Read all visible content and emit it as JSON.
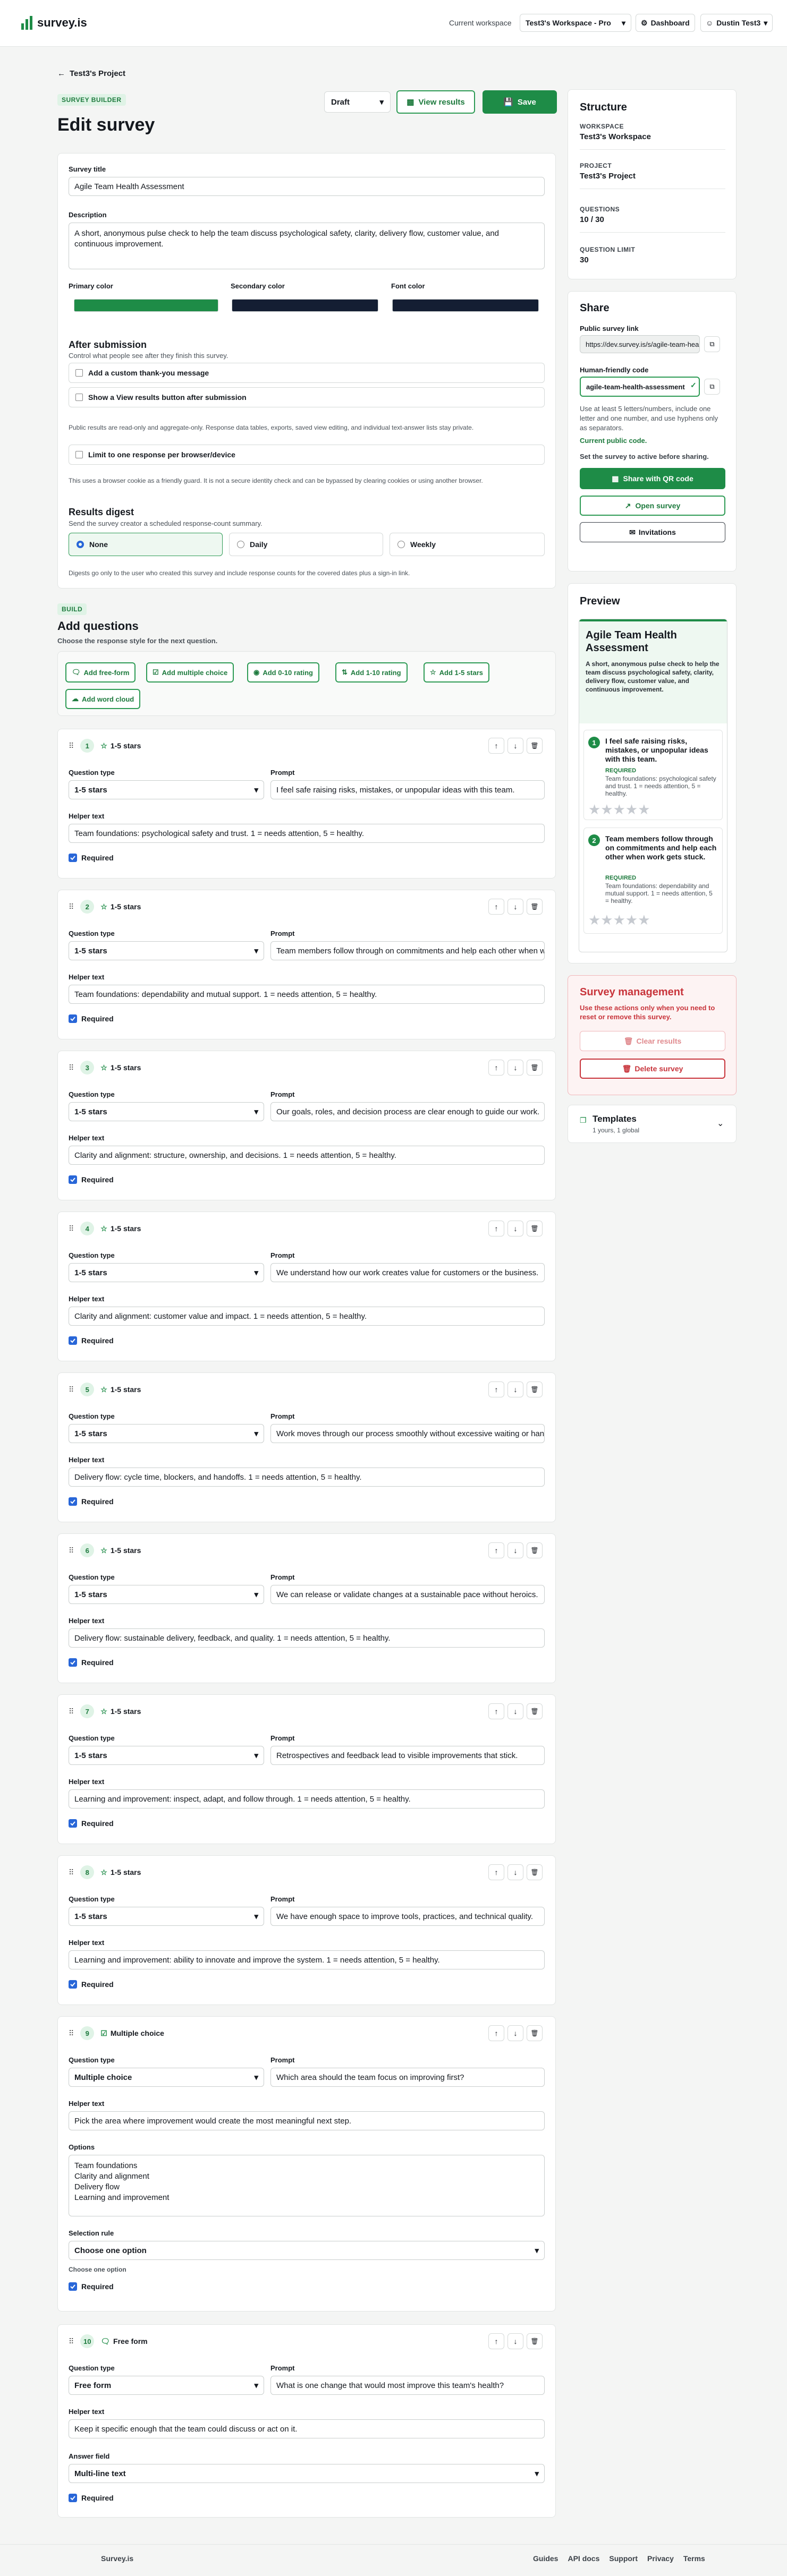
{
  "topbar": {
    "brand": "survey.is",
    "workspace_label": "Current workspace",
    "workspace_value": "Test3's Workspace - Pro",
    "dashboard": "Dashboard",
    "user": "Dustin Test3"
  },
  "header": {
    "back": "Test3's Project",
    "badge": "SURVEY BUILDER",
    "title": "Edit survey",
    "status": "Draft",
    "view_results": "View results",
    "save": "Save"
  },
  "settings": {
    "title_label": "Survey title",
    "title_value": "Agile Team Health Assessment",
    "desc_label": "Description",
    "desc_value": "A short, anonymous pulse check to help the team discuss psychological safety, clarity, delivery flow, customer value, and continuous improvement.",
    "primary_label": "Primary color",
    "primary_color": "#1e8c47",
    "secondary_label": "Secondary color",
    "secondary_color": "#141e33",
    "font_label": "Font color",
    "font_color": "#141e33",
    "after_title": "After submission",
    "after_sub": "Control what people see after they finish this survey.",
    "opt_thankyou": "Add a custom thank-you message",
    "opt_view": "Show a View results button after submission",
    "public_note": "Public results are read-only and aggregate-only. Response data tables, exports, saved view editing, and individual text-answer lists stay private.",
    "opt_limit": "Limit to one response per browser/device",
    "limit_note": "This uses a browser cookie as a friendly guard. It is not a secure identity check and can be bypassed by clearing cookies or using another browser.",
    "digest_title": "Results digest",
    "digest_sub": "Send the survey creator a scheduled response-count summary.",
    "digest_options": [
      "None",
      "Daily",
      "Weekly"
    ],
    "digest_note": "Digests go only to the user who created this survey and include response counts for the covered dates plus a sign-in link."
  },
  "build": {
    "badge": "BUILD",
    "title": "Add questions",
    "sub": "Choose the response style for the next question.",
    "buttons": [
      "Add free-form",
      "Add multiple choice",
      "Add 0-10 rating",
      "Add 1-10 rating",
      "Add 1-5 stars",
      "Add word cloud"
    ]
  },
  "labels": {
    "qtype": "Question type",
    "prompt": "Prompt",
    "helper": "Helper text",
    "required": "Required",
    "options": "Options",
    "selection_rule": "Selection rule",
    "choose_one": "Choose one option",
    "answer_field": "Answer field"
  },
  "questions": [
    {
      "n": "1",
      "type": "1-5 stars",
      "prompt": "I feel safe raising risks, mistakes, or unpopular ideas with this team.",
      "helper": "Team foundations: psychological safety and trust. 1 = needs attention, 5 = healthy."
    },
    {
      "n": "2",
      "type": "1-5 stars",
      "prompt": "Team members follow through on commitments and help each other when work gets stuck.",
      "helper": "Team foundations: dependability and mutual support. 1 = needs attention, 5 = healthy."
    },
    {
      "n": "3",
      "type": "1-5 stars",
      "prompt": "Our goals, roles, and decision process are clear enough to guide our work.",
      "helper": "Clarity and alignment: structure, ownership, and decisions. 1 = needs attention, 5 = healthy."
    },
    {
      "n": "4",
      "type": "1-5 stars",
      "prompt": "We understand how our work creates value for customers or the business.",
      "helper": "Clarity and alignment: customer value and impact. 1 = needs attention, 5 = healthy."
    },
    {
      "n": "5",
      "type": "1-5 stars",
      "prompt": "Work moves through our process smoothly without excessive waiting or handoffs.",
      "helper": "Delivery flow: cycle time, blockers, and handoffs. 1 = needs attention, 5 = healthy."
    },
    {
      "n": "6",
      "type": "1-5 stars",
      "prompt": "We can release or validate changes at a sustainable pace without heroics.",
      "helper": "Delivery flow: sustainable delivery, feedback, and quality. 1 = needs attention, 5 = healthy."
    },
    {
      "n": "7",
      "type": "1-5 stars",
      "prompt": "Retrospectives and feedback lead to visible improvements that stick.",
      "helper": "Learning and improvement: inspect, adapt, and follow through. 1 = needs attention, 5 = healthy."
    },
    {
      "n": "8",
      "type": "1-5 stars",
      "prompt": "We have enough space to improve tools, practices, and technical quality.",
      "helper": "Learning and improvement: ability to innovate and improve the system. 1 = needs attention, 5 = healthy."
    },
    {
      "n": "9",
      "type": "Multiple choice",
      "prompt": "Which area should the team focus on improving first?",
      "helper": "Pick the area where improvement would create the most meaningful next step.",
      "options": "Team foundations\nClarity and alignment\nDelivery flow\nLearning and improvement",
      "rule": "Choose one option",
      "rule_note": "Choose one option"
    },
    {
      "n": "10",
      "type": "Free form",
      "prompt": "What is one change that would most improve this team's health?",
      "helper": "Keep it specific enough that the team could discuss or act on it.",
      "answer": "Multi-line text"
    }
  ],
  "structure": {
    "title": "Structure",
    "ws_label": "WORKSPACE",
    "ws": "Test3's Workspace",
    "proj_label": "PROJECT",
    "proj": "Test3's Project",
    "q_label": "QUESTIONS",
    "q": "10 / 30",
    "limit_label": "QUESTION LIMIT",
    "limit": "30"
  },
  "share": {
    "title": "Share",
    "link_label": "Public survey link",
    "link": "https://dev.survey.is/s/agile-team-health-assessment",
    "code_label": "Human-friendly code",
    "code": "agile-team-health-assessment",
    "code_note": "Use at least 5 letters/numbers, include one letter and one number, and use hyphens only as separators.",
    "current": "Current public code.",
    "set_active": "Set the survey to active before sharing.",
    "qr": "Share with QR code",
    "open": "Open survey",
    "invite": "Invitations"
  },
  "preview": {
    "title": "Preview",
    "card_title": "Agile Team Health Assessment",
    "card_desc": "A short, anonymous pulse check to help the team discuss psychological safety, clarity, delivery flow, customer value, and continuous improvement.",
    "q1": "I feel safe raising risks, mistakes, or unpopular ideas with this team.",
    "q1_help": "Team foundations: psychological safety and trust. 1 = needs attention, 5 = healthy.",
    "q2": "Team members follow through on commitments and help each other when work gets stuck.",
    "q2_help": "Team foundations: dependability and mutual support. 1 = needs attention, 5 = healthy.",
    "required": "REQUIRED"
  },
  "manage": {
    "title": "Survey management",
    "sub": "Use these actions only when you need to reset or remove this survey.",
    "clear": "Clear results",
    "delete": "Delete survey"
  },
  "templates": {
    "title": "Templates",
    "sub": "1 yours, 1 global"
  },
  "footer": {
    "brand": "Survey.is",
    "links": [
      "Guides",
      "API docs",
      "Support",
      "Privacy",
      "Terms"
    ]
  },
  "colors": {
    "accent": "#1e8c47",
    "danger": "#c8343b"
  }
}
